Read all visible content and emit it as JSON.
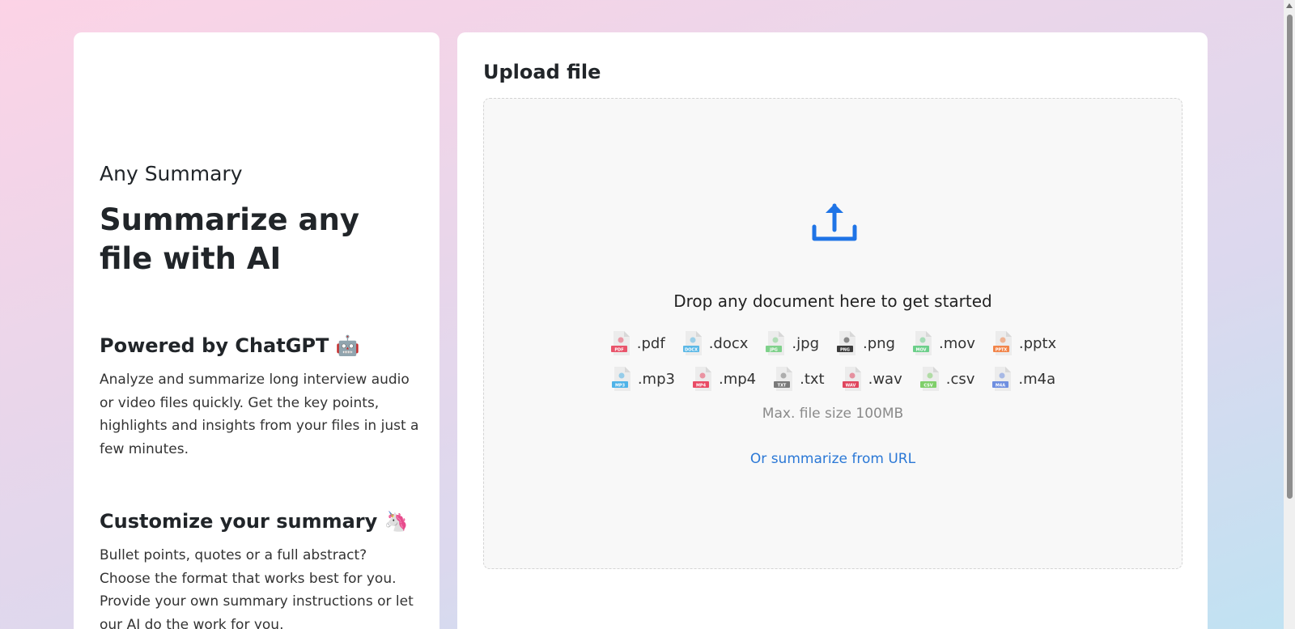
{
  "left": {
    "app_name": "Any Summary",
    "headline": "Summarize any file with AI",
    "features": [
      {
        "title": "Powered by ChatGPT 🤖",
        "text": "Analyze and summarize long interview audio or video files quickly. Get the key points, highlights and insights from your files in just a few minutes."
      },
      {
        "title": "Customize your summary 🦄",
        "text": "Bullet points, quotes or a full abstract? Choose the format that works best for you. Provide your own summary instructions or let our AI do the work for you."
      }
    ]
  },
  "upload": {
    "title": "Upload file",
    "drop_text": "Drop any document here to get started",
    "file_types_row1": [
      {
        "ext": ".pdf",
        "badge": "PDF",
        "color": "#e9546b"
      },
      {
        "ext": ".docx",
        "badge": "DOCX",
        "color": "#5bb8e6"
      },
      {
        "ext": ".jpg",
        "badge": "JPG",
        "color": "#7fd18b"
      },
      {
        "ext": ".png",
        "badge": "PNG",
        "color": "#3b3b3b"
      },
      {
        "ext": ".mov",
        "badge": "MOV",
        "color": "#6ccf8a"
      },
      {
        "ext": ".pptx",
        "badge": "PPTX",
        "color": "#f2854a"
      }
    ],
    "file_types_row2": [
      {
        "ext": ".mp3",
        "badge": "MP3",
        "color": "#4fb3e8"
      },
      {
        "ext": ".mp4",
        "badge": "MP4",
        "color": "#e94b65"
      },
      {
        "ext": ".txt",
        "badge": "TXT",
        "color": "#7a7a7a"
      },
      {
        "ext": ".wav",
        "badge": "WAV",
        "color": "#e0465e"
      },
      {
        "ext": ".csv",
        "badge": "CSV",
        "color": "#7fcf6a"
      },
      {
        "ext": ".m4a",
        "badge": "M4A",
        "color": "#6f8fe0"
      }
    ],
    "max_size": "Max. file size 100MB",
    "url_link": "Or summarize from URL"
  },
  "colors": {
    "accent": "#1f74e6",
    "link": "#2b78d6"
  }
}
